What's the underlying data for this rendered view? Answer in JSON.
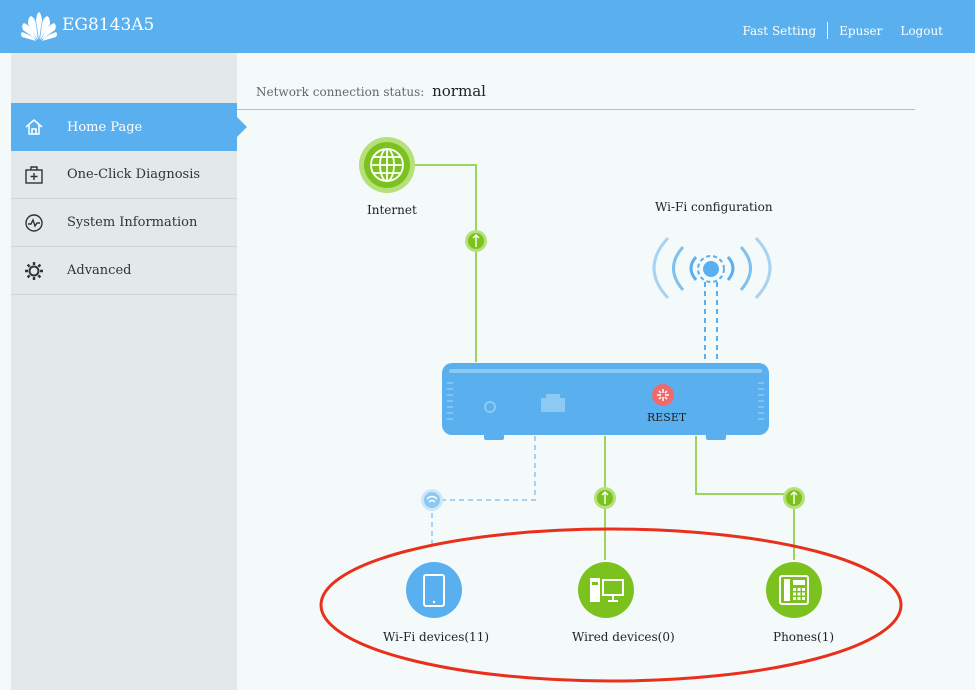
{
  "header": {
    "model": "EG8143A5",
    "links": {
      "fast_setting": "Fast Setting",
      "user": "Epuser",
      "logout": "Logout"
    }
  },
  "sidebar": {
    "items": [
      {
        "label": "Home Page",
        "icon": "home-icon",
        "active": true
      },
      {
        "label": "One-Click Diagnosis",
        "icon": "diagnosis-icon",
        "active": false
      },
      {
        "label": "System Information",
        "icon": "system-info-icon",
        "active": false
      },
      {
        "label": "Advanced",
        "icon": "gear-icon",
        "active": false
      }
    ]
  },
  "main": {
    "status_label": "Network connection status:",
    "status_value": "normal",
    "internet_label": "Internet",
    "wifi_config_label": "Wi-Fi configuration",
    "reset_label": "RESET",
    "devices": {
      "wifi": "Wi-Fi devices(11)",
      "wired": "Wired devices(0)",
      "phones": "Phones(1)"
    }
  },
  "colors": {
    "header": "#5ab0ef",
    "accent_green": "#7cc21e",
    "router_blue": "#5ab0ef",
    "reset_red": "#ef5a5a",
    "annotation_red": "#e8301c"
  }
}
